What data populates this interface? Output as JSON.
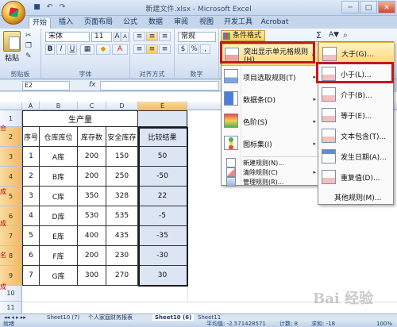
{
  "window": {
    "title": "新建文件.xlsx - Microsoft Excel",
    "buttons": [
      "─",
      "□",
      "✕"
    ]
  },
  "tabs": [
    "开始",
    "插入",
    "页面布局",
    "公式",
    "数据",
    "审阅",
    "视图",
    "开发工具",
    "Acrobat"
  ],
  "ribbon": {
    "paste_label": "粘贴",
    "font_name": "宋体",
    "font_size": "11",
    "number_format": "常规",
    "bold": "B",
    "italic": "I",
    "underline": "U",
    "percent": "%",
    "cond_format_label": "条件格式",
    "sum_symbol": "Σ",
    "sort_icon": "A▼",
    "groups": [
      "剪贴板",
      "字体",
      "对齐方式",
      "数字"
    ]
  },
  "formula_bar": {
    "name_box": "E2",
    "fx": "fx",
    "value": ""
  },
  "sheet": {
    "columns": [
      "A",
      "B",
      "C",
      "D",
      "E"
    ],
    "rows": [
      "1",
      "2",
      "3",
      "4",
      "5",
      "6",
      "7",
      "8",
      "9",
      "10",
      "11"
    ],
    "title": "生产量",
    "headers": [
      "序号",
      "仓库库位",
      "库存数",
      "安全库存",
      "比较结果"
    ],
    "data": [
      [
        "1",
        "A库",
        "200",
        "150",
        "50"
      ],
      [
        "2",
        "B库",
        "200",
        "250",
        "-50"
      ],
      [
        "3",
        "C库",
        "350",
        "328",
        "22"
      ],
      [
        "4",
        "D库",
        "530",
        "535",
        "-5"
      ],
      [
        "5",
        "E库",
        "400",
        "435",
        "-35"
      ],
      [
        "6",
        "F库",
        "200",
        "230",
        "-30"
      ],
      [
        "7",
        "G库",
        "300",
        "270",
        "30"
      ]
    ],
    "side_marks": [
      "合",
      "成",
      "成",
      "名",
      "成"
    ]
  },
  "menu_main": {
    "items": [
      {
        "label": "突出显示单元格规则(H)",
        "arrow": "▸"
      },
      {
        "label": "项目选取规则(T)",
        "arrow": "▸"
      },
      {
        "label": "数据条(D)",
        "arrow": "▸"
      },
      {
        "label": "色阶(S)",
        "arrow": "▸"
      },
      {
        "label": "图标集(I)",
        "arrow": "▸"
      }
    ],
    "small_items": [
      "新建规则(N)...",
      "清除规则(C)",
      "管理规则(R)..."
    ],
    "small_arrow": "▸"
  },
  "menu_sub": {
    "items": [
      "大于(G)...",
      "小于(L)...",
      "介于(B)...",
      "等于(E)...",
      "文本包含(T)...",
      "发生日期(A)...",
      "重复值(D)..."
    ],
    "other": "其他规则(M)..."
  },
  "sheet_tabs": [
    "Sheet10 (7)",
    "个人家庭财务报表",
    "Sheet10 (6)",
    "Sheet11"
  ],
  "status": {
    "ready": "就绪",
    "average": "平均值: -2.571428571",
    "count": "计数: 8",
    "sum": "求和: -18",
    "zoom": "100%"
  },
  "watermark": "Bai 经验"
}
